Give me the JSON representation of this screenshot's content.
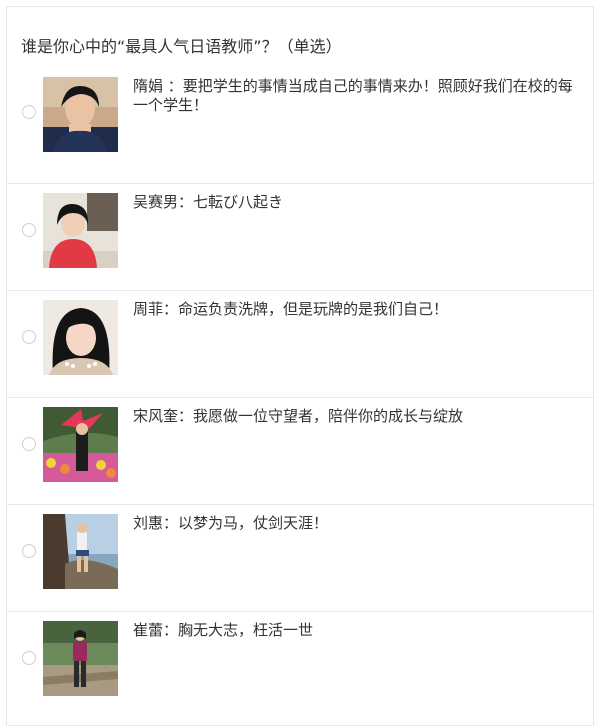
{
  "question": {
    "title": "谁是你心中的“最具人气日语教师”？（单选）"
  },
  "options": [
    {
      "label": "隋娟 ：要把学生的事情当成自己的事情来办！照顾好我们在校的每一个学生！",
      "photo": "teacher-photo-1"
    },
    {
      "label": "吴赛男：七転び八起き",
      "photo": "teacher-photo-2"
    },
    {
      "label": "周菲：命运负责洗牌，但是玩牌的是我们自己！",
      "photo": "teacher-photo-3"
    },
    {
      "label": "宋风奎：我愿做一位守望者，陪伴你的成长与绽放",
      "photo": "teacher-photo-4"
    },
    {
      "label": "刘惠：以梦为马，仗剑天涯！",
      "photo": "teacher-photo-5"
    },
    {
      "label": "崔蕾：胸无大志，枉活一世",
      "photo": "teacher-photo-6"
    }
  ]
}
